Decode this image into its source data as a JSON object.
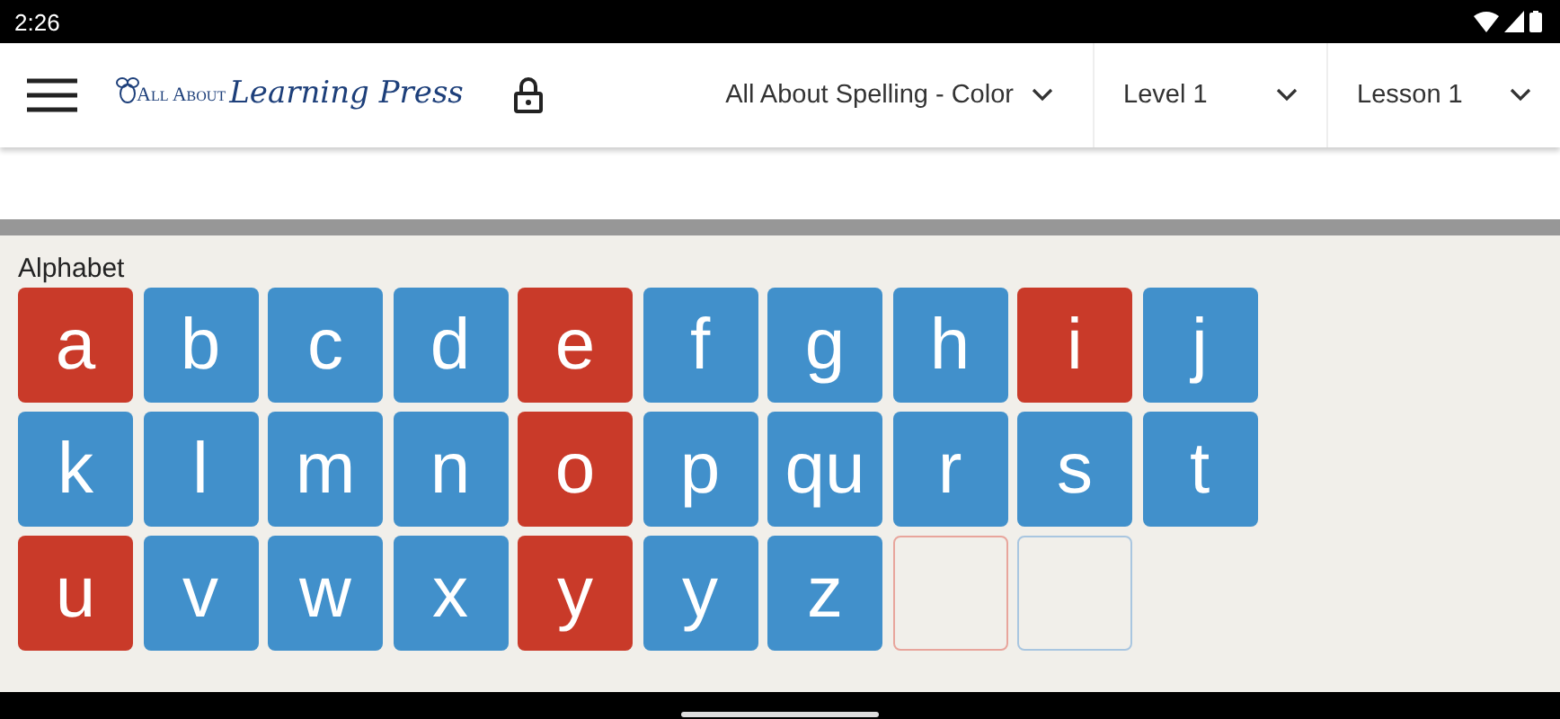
{
  "status_bar": {
    "time": "2:26"
  },
  "header": {
    "logo": {
      "small_caps": "All About",
      "script": "Learning Press"
    },
    "dropdowns": [
      {
        "label": "All About Spelling - Color"
      },
      {
        "label": "Level 1"
      },
      {
        "label": "Lesson 1"
      }
    ]
  },
  "section": {
    "title": "Alphabet",
    "rows": [
      [
        {
          "kind": "letter",
          "text": "a",
          "color": "#c93a29"
        },
        {
          "kind": "letter",
          "text": "b",
          "color": "#4190cb"
        },
        {
          "kind": "letter",
          "text": "c",
          "color": "#4190cb"
        },
        {
          "kind": "letter",
          "text": "d",
          "color": "#4190cb"
        },
        {
          "kind": "letter",
          "text": "e",
          "color": "#c93a29"
        },
        {
          "kind": "letter",
          "text": "f",
          "color": "#4190cb"
        },
        {
          "kind": "letter",
          "text": "g",
          "color": "#4190cb"
        },
        {
          "kind": "letter",
          "text": "h",
          "color": "#4190cb"
        },
        {
          "kind": "letter",
          "text": "i",
          "color": "#c93a29"
        },
        {
          "kind": "letter",
          "text": "j",
          "color": "#4190cb"
        }
      ],
      [
        {
          "kind": "letter",
          "text": "k",
          "color": "#4190cb"
        },
        {
          "kind": "letter",
          "text": "l",
          "color": "#4190cb"
        },
        {
          "kind": "letter",
          "text": "m",
          "color": "#4190cb"
        },
        {
          "kind": "letter",
          "text": "n",
          "color": "#4190cb"
        },
        {
          "kind": "letter",
          "text": "o",
          "color": "#c93a29"
        },
        {
          "kind": "letter",
          "text": "p",
          "color": "#4190cb"
        },
        {
          "kind": "letter",
          "text": "qu",
          "color": "#4190cb"
        },
        {
          "kind": "letter",
          "text": "r",
          "color": "#4190cb"
        },
        {
          "kind": "letter",
          "text": "s",
          "color": "#4190cb"
        },
        {
          "kind": "letter",
          "text": "t",
          "color": "#4190cb"
        }
      ],
      [
        {
          "kind": "letter",
          "text": "u",
          "color": "#c93a29"
        },
        {
          "kind": "letter",
          "text": "v",
          "color": "#4190cb"
        },
        {
          "kind": "letter",
          "text": "w",
          "color": "#4190cb"
        },
        {
          "kind": "letter",
          "text": "x",
          "color": "#4190cb"
        },
        {
          "kind": "letter",
          "text": "y",
          "color": "#c93a29"
        },
        {
          "kind": "letter",
          "text": "y",
          "color": "#4190cb"
        },
        {
          "kind": "letter",
          "text": "z",
          "color": "#4190cb"
        },
        {
          "kind": "blank",
          "color": "#e8a59c"
        },
        {
          "kind": "blank",
          "color": "#a9c6e0"
        }
      ]
    ]
  }
}
